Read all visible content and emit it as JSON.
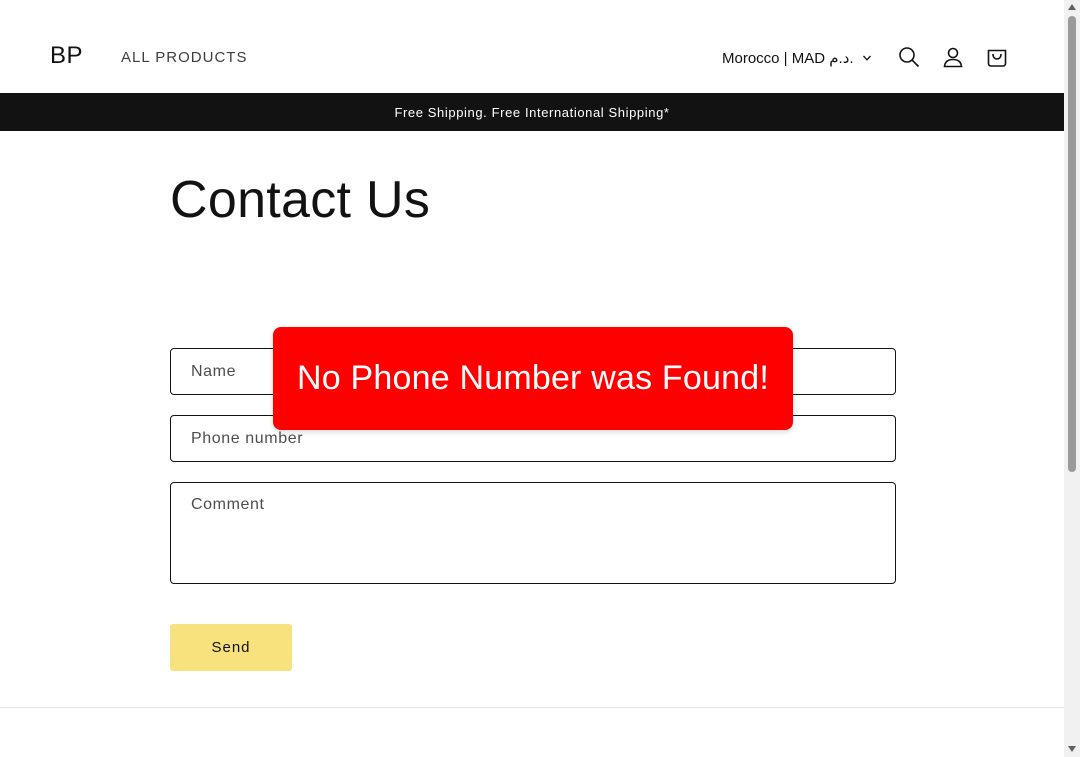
{
  "header": {
    "logo": "BP",
    "nav": {
      "all_products": "ALL PRODUCTS"
    },
    "locale": {
      "label": "Morocco | MAD د.م."
    },
    "icons": {
      "search": "search-icon",
      "account": "account-icon",
      "cart": "cart-icon"
    }
  },
  "announcement": {
    "text": "Free Shipping. Free International Shipping*"
  },
  "main": {
    "title": "Contact Us",
    "form": {
      "name_placeholder": "Name",
      "phone_placeholder": "Phone number",
      "comment_placeholder": "Comment",
      "send_label": "Send"
    }
  },
  "toast": {
    "message": "No Phone Number was Found!"
  },
  "colors": {
    "accent_button": "#f8e27d",
    "announcement_bg": "#121212",
    "toast_bg": "#ff0000"
  }
}
